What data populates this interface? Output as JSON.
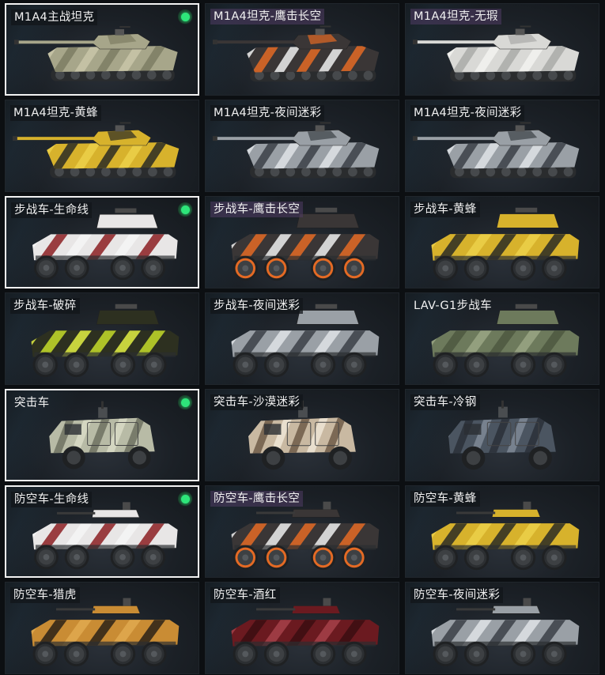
{
  "vehicles": [
    {
      "name": "M1A4主战坦克",
      "type": "tank",
      "skin": "desert",
      "selected": true,
      "tag": "dark"
    },
    {
      "name": "M1A4坦克-鹰击长空",
      "type": "tank",
      "skin": "eagle",
      "selected": false,
      "tag": "purple"
    },
    {
      "name": "M1A4坦克-无瑕",
      "type": "tank",
      "skin": "white",
      "selected": false,
      "tag": "purple"
    },
    {
      "name": "M1A4坦克-黄蜂",
      "type": "tank",
      "skin": "hornet",
      "selected": false,
      "tag": "dark"
    },
    {
      "name": "M1A4坦克-夜间迷彩",
      "type": "tank",
      "skin": "night",
      "selected": false,
      "tag": "dark"
    },
    {
      "name": "M1A4坦克-夜间迷彩",
      "type": "tank",
      "skin": "night",
      "selected": false,
      "tag": "dark"
    },
    {
      "name": "步战车-生命线",
      "type": "ifv",
      "skin": "lifeline",
      "selected": true,
      "tag": "dark"
    },
    {
      "name": "步战车-鹰击长空",
      "type": "ifv",
      "skin": "eagle",
      "selected": false,
      "tag": "purple"
    },
    {
      "name": "步战车-黄蜂",
      "type": "ifv",
      "skin": "hornet",
      "selected": false,
      "tag": "dark"
    },
    {
      "name": "步战车-破碎",
      "type": "ifv",
      "skin": "shatter",
      "selected": false,
      "tag": "dark"
    },
    {
      "name": "步战车-夜间迷彩",
      "type": "ifv",
      "skin": "night",
      "selected": false,
      "tag": "dark"
    },
    {
      "name": "LAV-G1步战车",
      "type": "ifv",
      "skin": "green",
      "selected": false,
      "tag": "plain"
    },
    {
      "name": "突击车",
      "type": "mrap",
      "skin": "olive",
      "selected": true,
      "tag": "plain"
    },
    {
      "name": "突击车-沙漠迷彩",
      "type": "mrap",
      "skin": "desertcamo",
      "selected": false,
      "tag": "dark"
    },
    {
      "name": "突击车-冷钢",
      "type": "mrap",
      "skin": "steel",
      "selected": false,
      "tag": "dark"
    },
    {
      "name": "防空车-生命线",
      "type": "aa",
      "skin": "lifeline",
      "selected": true,
      "tag": "dark"
    },
    {
      "name": "防空车-鹰击长空",
      "type": "aa",
      "skin": "eagle",
      "selected": false,
      "tag": "purple"
    },
    {
      "name": "防空车-黄蜂",
      "type": "aa",
      "skin": "hornet",
      "selected": false,
      "tag": "dark"
    },
    {
      "name": "防空车-猎虎",
      "type": "aa",
      "skin": "tiger",
      "selected": false,
      "tag": "dark"
    },
    {
      "name": "防空车-酒红",
      "type": "aa",
      "skin": "wine",
      "selected": false,
      "tag": "dark"
    },
    {
      "name": "防空车-夜间迷彩",
      "type": "aa",
      "skin": "night",
      "selected": false,
      "tag": "dark"
    }
  ],
  "skins": {
    "desert": {
      "base": "#a7a68a",
      "alt": "#7d7d63",
      "accent": "#c9c6a8"
    },
    "eagle": {
      "base": "#3a3636",
      "alt": "#e46a24",
      "accent": "#eeeeee"
    },
    "white": {
      "base": "#d9d9d6",
      "alt": "#a9aaa8",
      "accent": "#f2f2f0"
    },
    "hornet": {
      "base": "#d7b22c",
      "alt": "#2a2a24",
      "accent": "#ecd04a"
    },
    "night": {
      "base": "#9aa0a6",
      "alt": "#3b4046",
      "accent": "#dfe3e6"
    },
    "lifeline": {
      "base": "#e8e6e6",
      "alt": "#8c1e22",
      "accent": "#f5f5f5"
    },
    "shatter": {
      "base": "#2d3020",
      "alt": "#c6dc2a",
      "accent": "#e3f044"
    },
    "green": {
      "base": "#6d7a5c",
      "alt": "#4d5840",
      "accent": "#9aa684"
    },
    "olive": {
      "base": "#b8bba6",
      "alt": "#6d7160",
      "accent": "#d8dac6"
    },
    "desertcamo": {
      "base": "#c9b9a2",
      "alt": "#6e5a48",
      "accent": "#eee5d6"
    },
    "steel": {
      "base": "#4b5561",
      "alt": "#2a3038",
      "accent": "#7f8a96"
    },
    "tiger": {
      "base": "#c98c34",
      "alt": "#2a2118",
      "accent": "#e0a950"
    },
    "wine": {
      "base": "#6b1a20",
      "alt": "#3b0e12",
      "accent": "#a6424a"
    }
  },
  "status_icon": "equipped-indicator-icon",
  "status_color": "#2ee57a"
}
